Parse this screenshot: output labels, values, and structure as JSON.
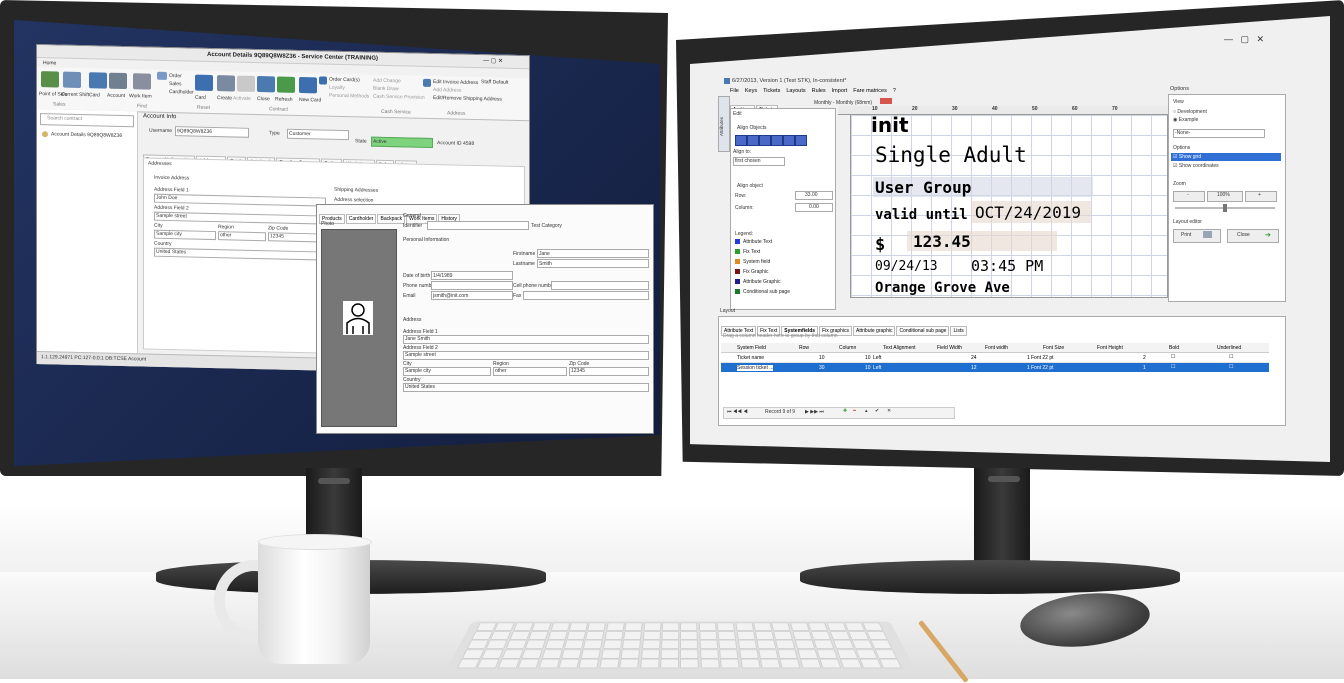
{
  "left_app": {
    "title": "Account Details 9Q89Q8W8Z36 - Service Center (TRAINING)",
    "quick_access": "Home",
    "ribbon_groups": [
      "Sales",
      "Find",
      "Reset",
      "Contract",
      "Cash Service",
      "Address"
    ],
    "ribbon_buttons": [
      "Point of Sale",
      "Current Shift",
      "Card",
      "Account",
      "Work Item",
      "Order",
      "Sales",
      "Cardholder",
      "Card",
      "Create",
      "Activate",
      "Close",
      "Refresh",
      "New Card",
      "Order Card(s)",
      "Loyalty",
      "Personal Methods",
      "Add Change",
      "Blank Draw",
      "Cash Service Provision",
      "Edit Invoice Address",
      "Add Address",
      "Edit/Remove Shipping Address"
    ],
    "user_label": "Staff Default",
    "search_placeholder": "Search contract",
    "tree_item": "Account Details 9Q89Q8W8Z36",
    "panel_title": "Account Info",
    "username_label": "Username",
    "username_value": "9Q89Q8W8Z36",
    "type_label": "Type",
    "type_value": "Customer",
    "state_label": "State",
    "state_value": "Active",
    "account_id_label": "Account ID",
    "account_id_value": "4598",
    "tabs": [
      "Personal Information",
      "Addresses",
      "Cards",
      "Autoloads",
      "Funding Sources",
      "Orders",
      "Work Items",
      "Sales",
      "History"
    ],
    "addresses_header": "Addresses",
    "invoice_header": "Invoice Address",
    "shipping_header": "Shipping Addresses",
    "address_selection": "Address selection",
    "addr_field1_label": "Address Field 1",
    "addr_field1_value": "John Doe",
    "addr_field2_label": "Address Field 2",
    "addr_field2_value": "Sample street",
    "city_label": "City",
    "city_value": "Sample city",
    "region_label": "Region",
    "region_value": "other",
    "zip_label": "Zip Code",
    "zip_value": "12345",
    "country_label": "Country",
    "country_value": "United States",
    "status_bar": "1.1.129.24971   PC:127-0:0:1   DB:TCSE   Account"
  },
  "left_overlay": {
    "tabs": [
      "Products",
      "Cardholder",
      "Backpack",
      "Work Items",
      "History"
    ],
    "photo_label": "Photo",
    "general_label": "General",
    "identifier_label": "Identifier",
    "test_category_label": "Test Category",
    "personal_info_header": "Personal Information",
    "firstname_label": "Firstname",
    "firstname_value": "Jane",
    "lastname_label": "Lastname",
    "lastname_value": "Smith",
    "dob_label": "Date of birth",
    "dob_value": "1/4/1989",
    "phone_label": "Phone number",
    "cell_label": "Cell phone number",
    "email_label": "Email",
    "email_value": "jsmith@init.com",
    "fax_label": "Fax",
    "address_header": "Address",
    "addr1_label": "Address Field 1",
    "addr1_value": "Jane Smith",
    "addr2_label": "Address Field 2",
    "addr2_value": "Sample street",
    "city_label": "City",
    "city_value": "Sample city",
    "region_label": "Region",
    "region_value": "other",
    "zip_label": "Zip Code",
    "zip_value": "12345",
    "country_label": "Country",
    "country_value": "United States"
  },
  "right_app": {
    "title": "6/27/2013, Version 1 (Test STK), In-consistent*",
    "menu": [
      "File",
      "Keys",
      "Tickets",
      "Layouts",
      "Rules",
      "Import",
      "Fare matrices",
      "?"
    ],
    "tabs": [
      "Archives",
      "Tickets"
    ],
    "doc_tab": "Monthly - Monthly (68mm)",
    "side_tab": "Attributes",
    "edit_label": "Edit",
    "align_objects_label": "Align Objects",
    "align_to_label": "Align to:",
    "align_to_value": "first chosen",
    "align_object_label": "Align object",
    "row_label": "Row:",
    "row_value": "33.00",
    "column_label": "Column:",
    "column_value": "0.00",
    "legend_title": "Legend:",
    "legend": [
      {
        "label": "Attribute Text",
        "color": "#1f3fd6"
      },
      {
        "label": "Fix Text",
        "color": "#2aa02a"
      },
      {
        "label": "System field",
        "color": "#e08a1f"
      },
      {
        "label": "Fix Graphic",
        "color": "#7a1414"
      },
      {
        "label": "Attribute Graphic",
        "color": "#1e1e8e"
      },
      {
        "label": "Conditional sub page",
        "color": "#1a7a2a"
      }
    ],
    "ruler": [
      "10",
      "20",
      "30",
      "40",
      "50",
      "60",
      "70"
    ],
    "ticket": {
      "logo": "init",
      "line1": "Single Adult",
      "line2": "User Group",
      "line3_label": "valid until",
      "line3_value": "OCT/24/2019",
      "line4_currency": "$",
      "line4_amount": "123.45",
      "line5_date": "09/24/13",
      "line5_time": "03:45 PM",
      "line6": "Orange Grove Ave"
    },
    "options_title": "Options",
    "view_label": "View",
    "view_opt1": "Development",
    "view_opt2": "Example",
    "none_select": "-None-",
    "options_label": "Options",
    "show_grid": "Show grid",
    "show_coords": "Show coordinates",
    "zoom_label": "Zoom",
    "zoom_minus": "-",
    "zoom_value": "100%",
    "zoom_plus": "+",
    "layout_editor_label": "Layout editor",
    "print_label": "Print",
    "close_label": "Close",
    "layout_header": "Layout",
    "bottom_tabs": [
      "Attribute Text",
      "Fix Text",
      "Systemfields",
      "Fix graphics",
      "Attribute graphic",
      "Conditional sub page",
      "Lists"
    ],
    "group_hint": "Drag a column header here to group by that column",
    "columns": [
      "System Field",
      "Row",
      "Column",
      "Text Alignment",
      "Field Width",
      "Font width",
      "Font Size",
      "Font Height",
      "Bold",
      "Underlined"
    ],
    "rows": [
      {
        "field": "Ticket name",
        "row": "10",
        "col": "10",
        "align": "Left",
        "width": "24",
        "fwidth": "1",
        "size": "Font 22 pt",
        "height": "2"
      },
      {
        "field": "Session ticket ...",
        "row": "30",
        "col": "10",
        "align": "Left",
        "width": "12",
        "fwidth": "1",
        "size": "Font 22 pt",
        "height": "1"
      }
    ],
    "record_nav": "Record 9 of 9"
  }
}
